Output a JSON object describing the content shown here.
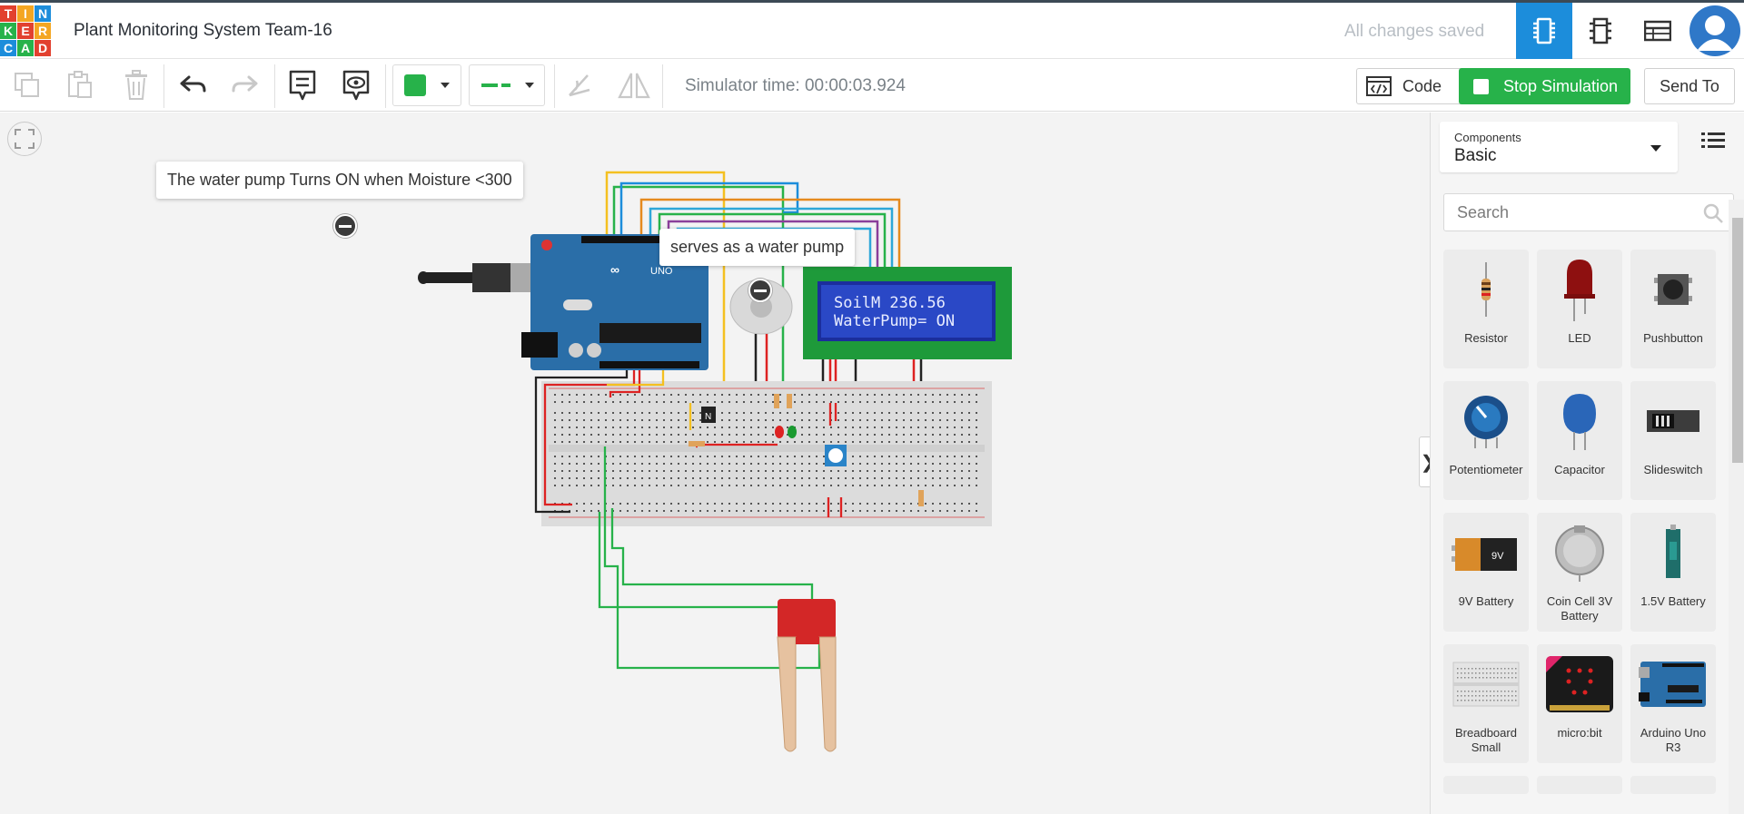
{
  "header": {
    "logo_letters": [
      "T",
      "I",
      "N",
      "K",
      "E",
      "R",
      "C",
      "A",
      "D"
    ],
    "logo_colors": [
      "#e2412f",
      "#f4a622",
      "#1c8ddb",
      "#27b24a",
      "#e2412f",
      "#f4a622",
      "#1c8ddb",
      "#27b24a",
      "#e2412f"
    ],
    "project_title": "Plant Monitoring System Team-16",
    "save_status": "All changes saved",
    "view_buttons": [
      "circuit-view",
      "schematic-view",
      "component-list-view"
    ]
  },
  "toolbar": {
    "simulator_time": "Simulator time: 00:00:03.924",
    "code_label": "Code",
    "stop_label": "Stop Simulation",
    "send_label": "Send To",
    "fill_color": "#27b24a",
    "accent_color": "#1c8ddb"
  },
  "canvas": {
    "notes": [
      {
        "text": "The water pump Turns ON when Moisture <300"
      },
      {
        "text": "serves as a water pump"
      }
    ],
    "lcd_line1": "SoilM 236.56",
    "lcd_line2": "WaterPump= ON"
  },
  "panel": {
    "components_label": "Components",
    "components_value": "Basic",
    "search_placeholder": "Search",
    "items": [
      {
        "label": "Resistor"
      },
      {
        "label": "LED"
      },
      {
        "label": "Pushbutton"
      },
      {
        "label": "Potentiometer"
      },
      {
        "label": "Capacitor"
      },
      {
        "label": "Slideswitch"
      },
      {
        "label": "9V Battery"
      },
      {
        "label": "Coin Cell 3V Battery"
      },
      {
        "label": "1.5V Battery"
      },
      {
        "label": "Breadboard Small"
      },
      {
        "label": "micro:bit"
      },
      {
        "label": "Arduino Uno R3"
      }
    ]
  }
}
